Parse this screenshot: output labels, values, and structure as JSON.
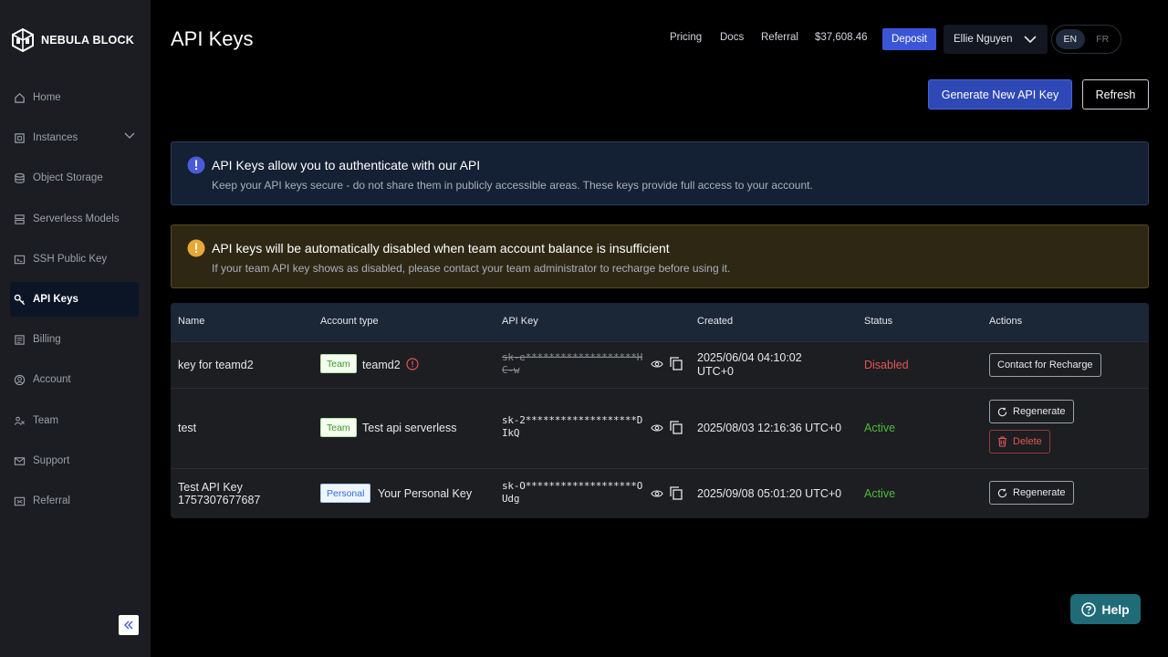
{
  "brand": {
    "name": "NEBULA BLOCK"
  },
  "sidebar": {
    "items": [
      {
        "label": "Home",
        "icon": "home-icon"
      },
      {
        "label": "Instances",
        "icon": "chip-icon"
      },
      {
        "label": "Object Storage",
        "icon": "database-icon"
      },
      {
        "label": "Serverless Models",
        "icon": "server-icon"
      },
      {
        "label": "SSH Public Key",
        "icon": "ssh-key-icon"
      },
      {
        "label": "API Keys",
        "icon": "key-icon",
        "active": true
      },
      {
        "label": "Billing",
        "icon": "billing-icon"
      },
      {
        "label": "Account",
        "icon": "account-icon"
      },
      {
        "label": "Team",
        "icon": "team-icon"
      },
      {
        "label": "Support",
        "icon": "mail-icon"
      },
      {
        "label": "Referral",
        "icon": "referral-icon"
      }
    ]
  },
  "header": {
    "title": "API Keys",
    "nav": [
      "Pricing",
      "Docs",
      "Referral"
    ],
    "balance": "$37,608.46",
    "deposit_label": "Deposit",
    "user_name": "Ellie Nguyen",
    "languages": [
      "EN",
      "FR"
    ],
    "active_language": "EN"
  },
  "actions": {
    "generate_label": "Generate New API Key",
    "refresh_label": "Refresh"
  },
  "alerts": {
    "info": {
      "title": "API Keys allow you to authenticate with our API",
      "desc": "Keep your API keys secure - do not share them in publicly accessible areas. These keys provide full access to your account."
    },
    "warning": {
      "title": "API keys will be automatically disabled when team account balance is insufficient",
      "desc": "If your team API key shows as disabled, please contact your team administrator to recharge before using it."
    }
  },
  "table": {
    "columns": [
      "Name",
      "Account type",
      "API Key",
      "Created",
      "Status",
      "Actions"
    ],
    "rows": [
      {
        "name": "key for teamd2",
        "account_tag": "Team",
        "account_name": "teamd2",
        "api_key": "sk-e*******************HC-w",
        "created": "2025/06/04 04:10:02 UTC+0",
        "status": "Disabled",
        "actions": [
          "Contact for Recharge"
        ]
      },
      {
        "name": "test",
        "account_tag": "Team",
        "account_name": "Test api serverless",
        "api_key": "sk-2*******************DIkQ",
        "created": "2025/08/03 12:16:36 UTC+0",
        "status": "Active",
        "actions": [
          "Regenerate",
          "Delete"
        ]
      },
      {
        "name": "Test API Key 1757307677687",
        "account_tag": "Personal",
        "account_name": "Your Personal Key",
        "api_key": "sk-O*******************OUdg",
        "created": "2025/09/08 05:01:20 UTC+0",
        "status": "Active",
        "actions": [
          "Regenerate"
        ]
      }
    ]
  },
  "help": {
    "label": "Help"
  },
  "colors": {
    "accent": "#3b55d9",
    "active": "#4fbb3b",
    "disabled": "#e25555",
    "sidebar": "#1b1d22"
  }
}
